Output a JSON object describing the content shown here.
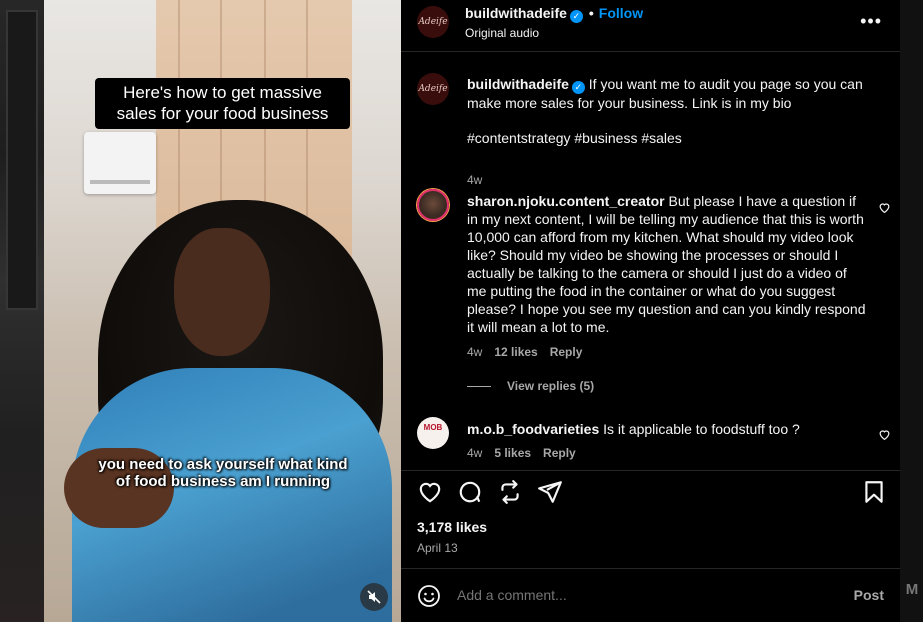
{
  "video": {
    "caption_top": "Here's how to get massive sales for your food business",
    "caption_bottom": "you need to ask yourself what kind of food business am I running",
    "mute_icon": "muted-speaker-icon"
  },
  "header": {
    "avatar_text": "Adeife",
    "username": "buildwithadeife",
    "verified_mark": "✓",
    "separator": "•",
    "follow_label": "Follow",
    "audio_label": "Original audio",
    "more_icon": "•••"
  },
  "caption": {
    "avatar_text": "Adeife",
    "username": "buildwithadeife",
    "text": "If you want me to audit you page so you can make more sales for your business. Link is in my bio",
    "hashtags": "#contentstrategy #business #sales",
    "time": "4w"
  },
  "comments": [
    {
      "username": "sharon.njoku.content_creator",
      "text": "But please I have a question if in my next content, I will be telling my audience that this is worth 10,000 can afford from my kitchen. What should my video look like? Should my video be showing the processes or should I actually be talking to the camera or should I just do a video of me putting the food in the container or what do you suggest please? I hope you see my question and can you kindly respond it will mean a lot to me.",
      "time": "4w",
      "likes": "12 likes",
      "reply_label": "Reply",
      "view_replies": "View replies (5)"
    },
    {
      "username": "m.o.b_foodvarieties",
      "avatar_text": "MOB",
      "text": "Is it applicable to foodstuff too ?",
      "time": "4w",
      "likes": "5 likes",
      "reply_label": "Reply"
    }
  ],
  "stats": {
    "likes": "3,178 likes",
    "date": "April 13"
  },
  "composer": {
    "placeholder": "Add a comment...",
    "post_label": "Post"
  },
  "background": {
    "right_letter": "M"
  },
  "colors": {
    "accent": "#0095f6",
    "panel_bg": "#000000",
    "muted_text": "#a8a8a8"
  }
}
